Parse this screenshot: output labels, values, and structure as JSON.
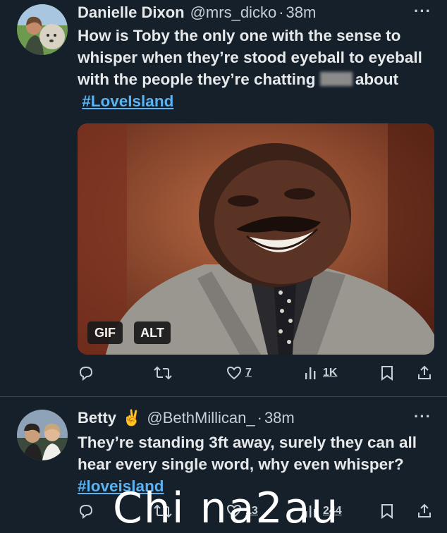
{
  "tweet1": {
    "display_name": "Danielle Dixon",
    "handle": "@mrs_dicko",
    "dot": "·",
    "time": "38m",
    "more": "···",
    "text_plain": "How is Toby the only one with the sense to whisper when they’re stood eyeball to eyeball with the people they’re chatting",
    "text_after_blur": "about",
    "hashtag": "#LoveIsland",
    "media": {
      "gif_badge": "GIF",
      "alt_badge": "ALT"
    },
    "actions": {
      "reply_icon": "reply-icon",
      "retweet_icon": "retweet-icon",
      "like_icon": "heart-icon",
      "like_count": "7",
      "views_icon": "views-chart-icon",
      "views_count": "1K",
      "bookmark_icon": "bookmark-icon",
      "share_icon": "share-icon"
    }
  },
  "tweet2": {
    "display_name": "Betty",
    "emoji": "✌️",
    "handle": "@BethMillican_",
    "dot": "·",
    "time": "38m",
    "more": "···",
    "text_plain": "They’re standing 3ft away, surely they can all hear every single word, why even whisper?",
    "hashtag": "#loveisland",
    "actions": {
      "like_count": "13",
      "views_count": "244"
    }
  },
  "watermark": "Chi na2au",
  "colors": {
    "background": "#15202b",
    "text": "#e7e9ea",
    "secondary": "#c7ced4",
    "link": "#5ab2f0",
    "divider": "#38444d"
  }
}
